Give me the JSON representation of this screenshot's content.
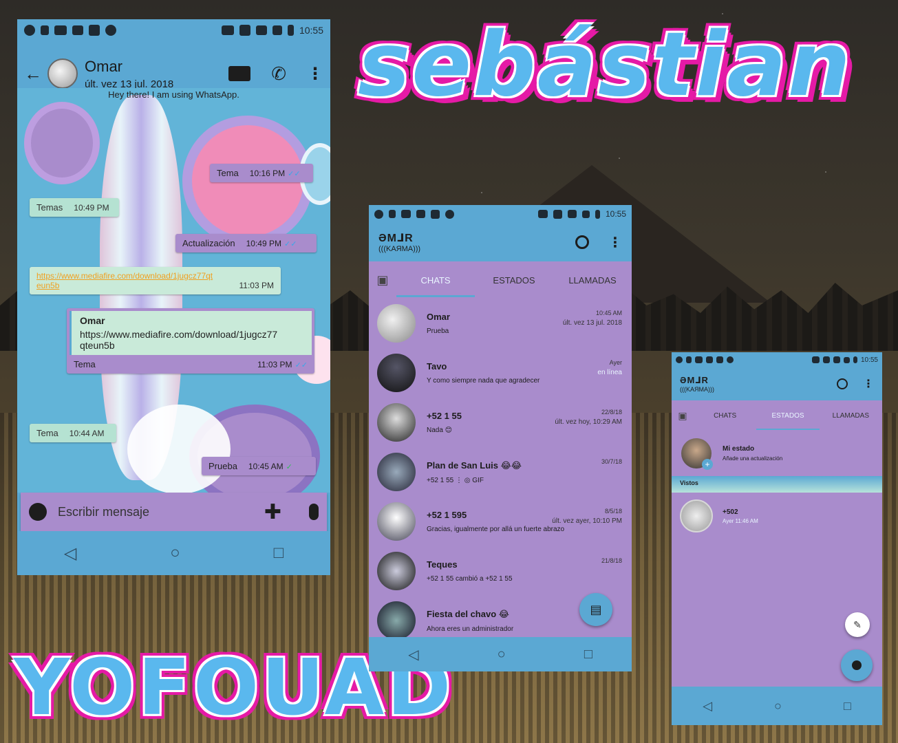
{
  "titles": {
    "top": "sebástian",
    "bottom": "YOFOUAD"
  },
  "statusbar": {
    "time": "10:55"
  },
  "chat": {
    "contact_name": "Omar",
    "contact_status": "últ. vez 13 jul. 2018",
    "banner": "Hey there! I am using WhatsApp.",
    "messages": [
      {
        "text": "Tema",
        "time": "10:16 PM",
        "dir": "out"
      },
      {
        "text": "Temas",
        "time": "10:49 PM",
        "dir": "in"
      },
      {
        "text": "Actualización",
        "time": "10:49 PM",
        "dir": "out"
      },
      {
        "text": "https://www.mediafire.com/download/1jugcz77qteun5b",
        "time": "11:03 PM",
        "dir": "in"
      },
      {
        "quote_name": "Omar",
        "quote_text": "https://www.mediafire.com/download/1jugcz77qteun5b",
        "text": "Tema",
        "time": "11:03 PM",
        "dir": "out"
      },
      {
        "text": "Tema",
        "time": "10:44 AM",
        "dir": "in"
      },
      {
        "text": "Prueba",
        "time": "10:45 AM",
        "dir": "out"
      }
    ],
    "composer_placeholder": "Escribir mensaje"
  },
  "brand": {
    "name": "ƏM⅃R",
    "sub": "(((KAЯMA)))"
  },
  "tabs": [
    "CHATS",
    "ESTADOS",
    "LLAMADAS"
  ],
  "chats": [
    {
      "name": "Omar",
      "msg": "Prueba",
      "time": "10:45 AM",
      "sub": "últ. vez 13 jul. 2018"
    },
    {
      "name": "Tavo",
      "msg": "Y como siempre nada que agradecer",
      "time": "Ayer",
      "sub": "en línea"
    },
    {
      "name": "+52 1 55",
      "msg": "Nada 😊",
      "time": "22/8/18",
      "sub": "últ. vez hoy, 10:29 AM"
    },
    {
      "name": "Plan de San Luis 😂😂",
      "msg": "+52 1 55 ⋮ ◎ GIF",
      "time": "30/7/18",
      "sub": ""
    },
    {
      "name": "+52 1 595",
      "msg": "Gracias, igualmente por allá un fuerte abrazo",
      "time": "8/5/18",
      "sub": "últ. vez ayer, 10:10 PM"
    },
    {
      "name": "Teques",
      "msg": "+52 1 55 cambió a +52 1 55",
      "time": "21/8/18",
      "sub": ""
    },
    {
      "name": "Fiesta del chavo 😂",
      "msg": "Ahora eres un administrador",
      "time": "",
      "sub": ""
    }
  ],
  "status": {
    "my_status": "Mi estado",
    "my_status_sub": "Añade una actualización",
    "section_viewed": "Vistos",
    "viewed": [
      {
        "name": "+502",
        "time": "Ayer 11:46 AM"
      }
    ]
  },
  "colors": {
    "blue": "#5ba8d3",
    "purple": "#a98ccc",
    "pink": "#e51aa6"
  }
}
